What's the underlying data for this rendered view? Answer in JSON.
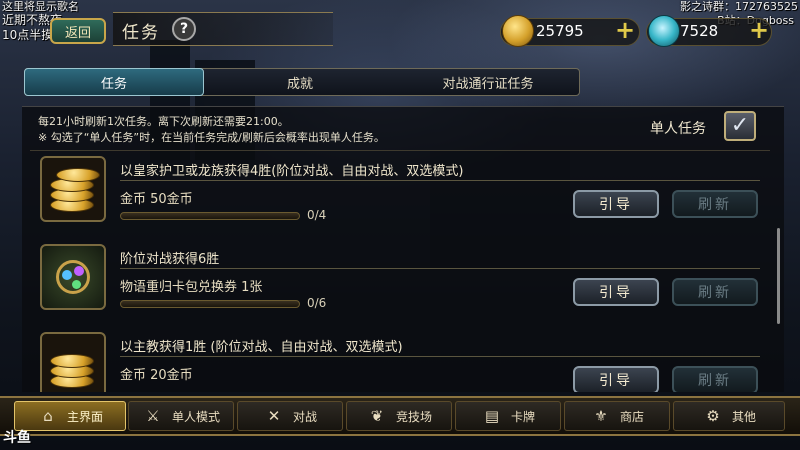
{
  "overlay": {
    "top_left_1": "这里将显示歌名",
    "top_left_2": "近期不熬夜",
    "top_left_3": "10点半摸",
    "top_right_1": "影之诗群：172763525",
    "top_right_2": "B站：Dogboss"
  },
  "header": {
    "back_label": "返回",
    "title": "任务",
    "help_glyph": "?",
    "gold": "25795",
    "gems": "7528",
    "plus_glyph": "+"
  },
  "tabs": [
    {
      "label": "任务",
      "active": true
    },
    {
      "label": "成就",
      "active": false
    },
    {
      "label": "对战通行证任务",
      "active": false
    }
  ],
  "info": {
    "line1": "每21小时刷新1次任务。离下次刷新还需要21:00。",
    "line2": "※ 勾选了“单人任务”时，在当前任务完成/刷新后会概率出现单人任务。",
    "solo_label": "单人任务",
    "solo_checked": true,
    "check_glyph": "✓"
  },
  "quests": [
    {
      "icon": "gold-coins-icon",
      "title": "以皇家护卫或龙族获得4胜(阶位对战、自由对战、双选模式)",
      "reward": "金币 50金币",
      "progress": "0/4",
      "progress_fraction": 0,
      "guide": "引导",
      "refresh": "刷新"
    },
    {
      "icon": "card-pack-ticket-icon",
      "title": "阶位对战获得6胜",
      "reward": "物语重归卡包兑换券 1张",
      "progress": "0/6",
      "progress_fraction": 0,
      "guide": "引导",
      "refresh": "刷新"
    },
    {
      "icon": "gold-coins-icon",
      "title": "以主教获得1胜 (阶位对战、自由对战、双选模式)",
      "reward": "金币 20金币",
      "progress": "",
      "progress_fraction": 0,
      "guide": "引导",
      "refresh": "刷新"
    }
  ],
  "nav": [
    {
      "label": "主界面",
      "icon": "home-icon",
      "glyph": "⌂",
      "active": true
    },
    {
      "label": "单人模式",
      "icon": "solo-sword-icon",
      "glyph": "⚔",
      "active": false
    },
    {
      "label": "对战",
      "icon": "crossed-swords-icon",
      "glyph": "✕",
      "active": false
    },
    {
      "label": "竞技场",
      "icon": "arena-laurel-icon",
      "glyph": "❦",
      "active": false
    },
    {
      "label": "卡牌",
      "icon": "cards-icon",
      "glyph": "▤",
      "active": false
    },
    {
      "label": "商店",
      "icon": "shop-icon",
      "glyph": "⚜",
      "active": false
    },
    {
      "label": "其他",
      "icon": "other-icon",
      "glyph": "⚙",
      "active": false
    }
  ],
  "watermark": "斗鱼",
  "colors": {
    "accent_gold": "#e0b84a",
    "tab_active": "#2e6a7e",
    "nav_active": "#8c6e22"
  }
}
